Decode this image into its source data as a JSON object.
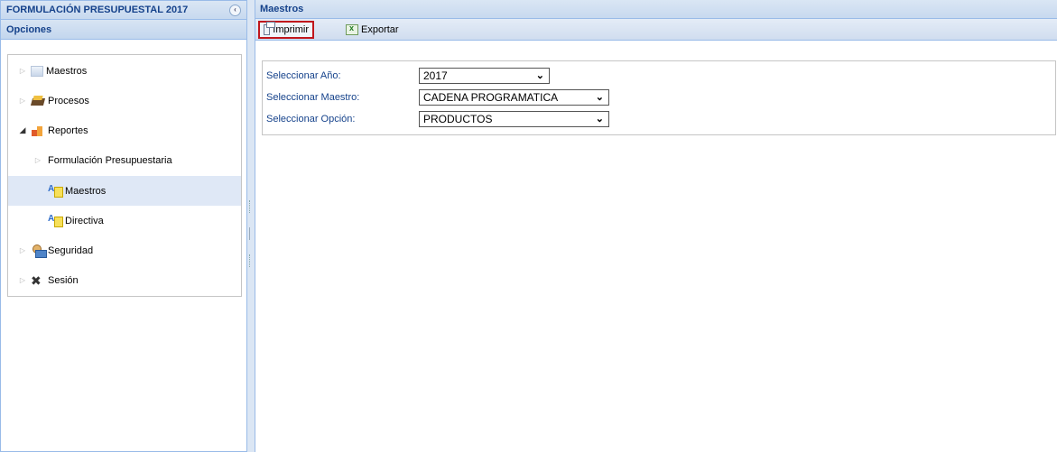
{
  "left_panel": {
    "title": "FORMULACIÓN PRESUPUESTAL 2017",
    "collapse_icon": "chevron-left-icon",
    "options_header": "Opciones",
    "tree": [
      {
        "label": "Maestros",
        "icon": "maestros-icon",
        "expanded": false
      },
      {
        "label": "Procesos",
        "icon": "procesos-icon",
        "expanded": false
      },
      {
        "label": "Reportes",
        "icon": "reportes-icon",
        "expanded": true
      },
      {
        "label": "Formulación Presupuestaria",
        "icon": "",
        "expanded": false
      },
      {
        "label": "Maestros",
        "icon": "report-doc-icon",
        "selected": true
      },
      {
        "label": "Directiva",
        "icon": "report-doc-icon"
      },
      {
        "label": "Seguridad",
        "icon": "seguridad-icon",
        "expanded": false
      },
      {
        "label": "Sesión",
        "icon": "sesion-icon",
        "expanded": false
      }
    ]
  },
  "right_panel": {
    "title": "Maestros",
    "toolbar": {
      "print_label": "Imprimir",
      "export_label": "Exportar"
    },
    "form": {
      "year": {
        "label": "Seleccionar Año:",
        "value": "2017"
      },
      "master": {
        "label": "Seleccionar Maestro:",
        "value": "CADENA PROGRAMATICA"
      },
      "option": {
        "label": "Seleccionar Opción:",
        "value": "PRODUCTOS"
      }
    }
  },
  "colors": {
    "header_text": "#15428b",
    "panel_border": "#99bbe8",
    "selected_row": "#dfe8f6",
    "highlight_border": "#c0161c"
  }
}
